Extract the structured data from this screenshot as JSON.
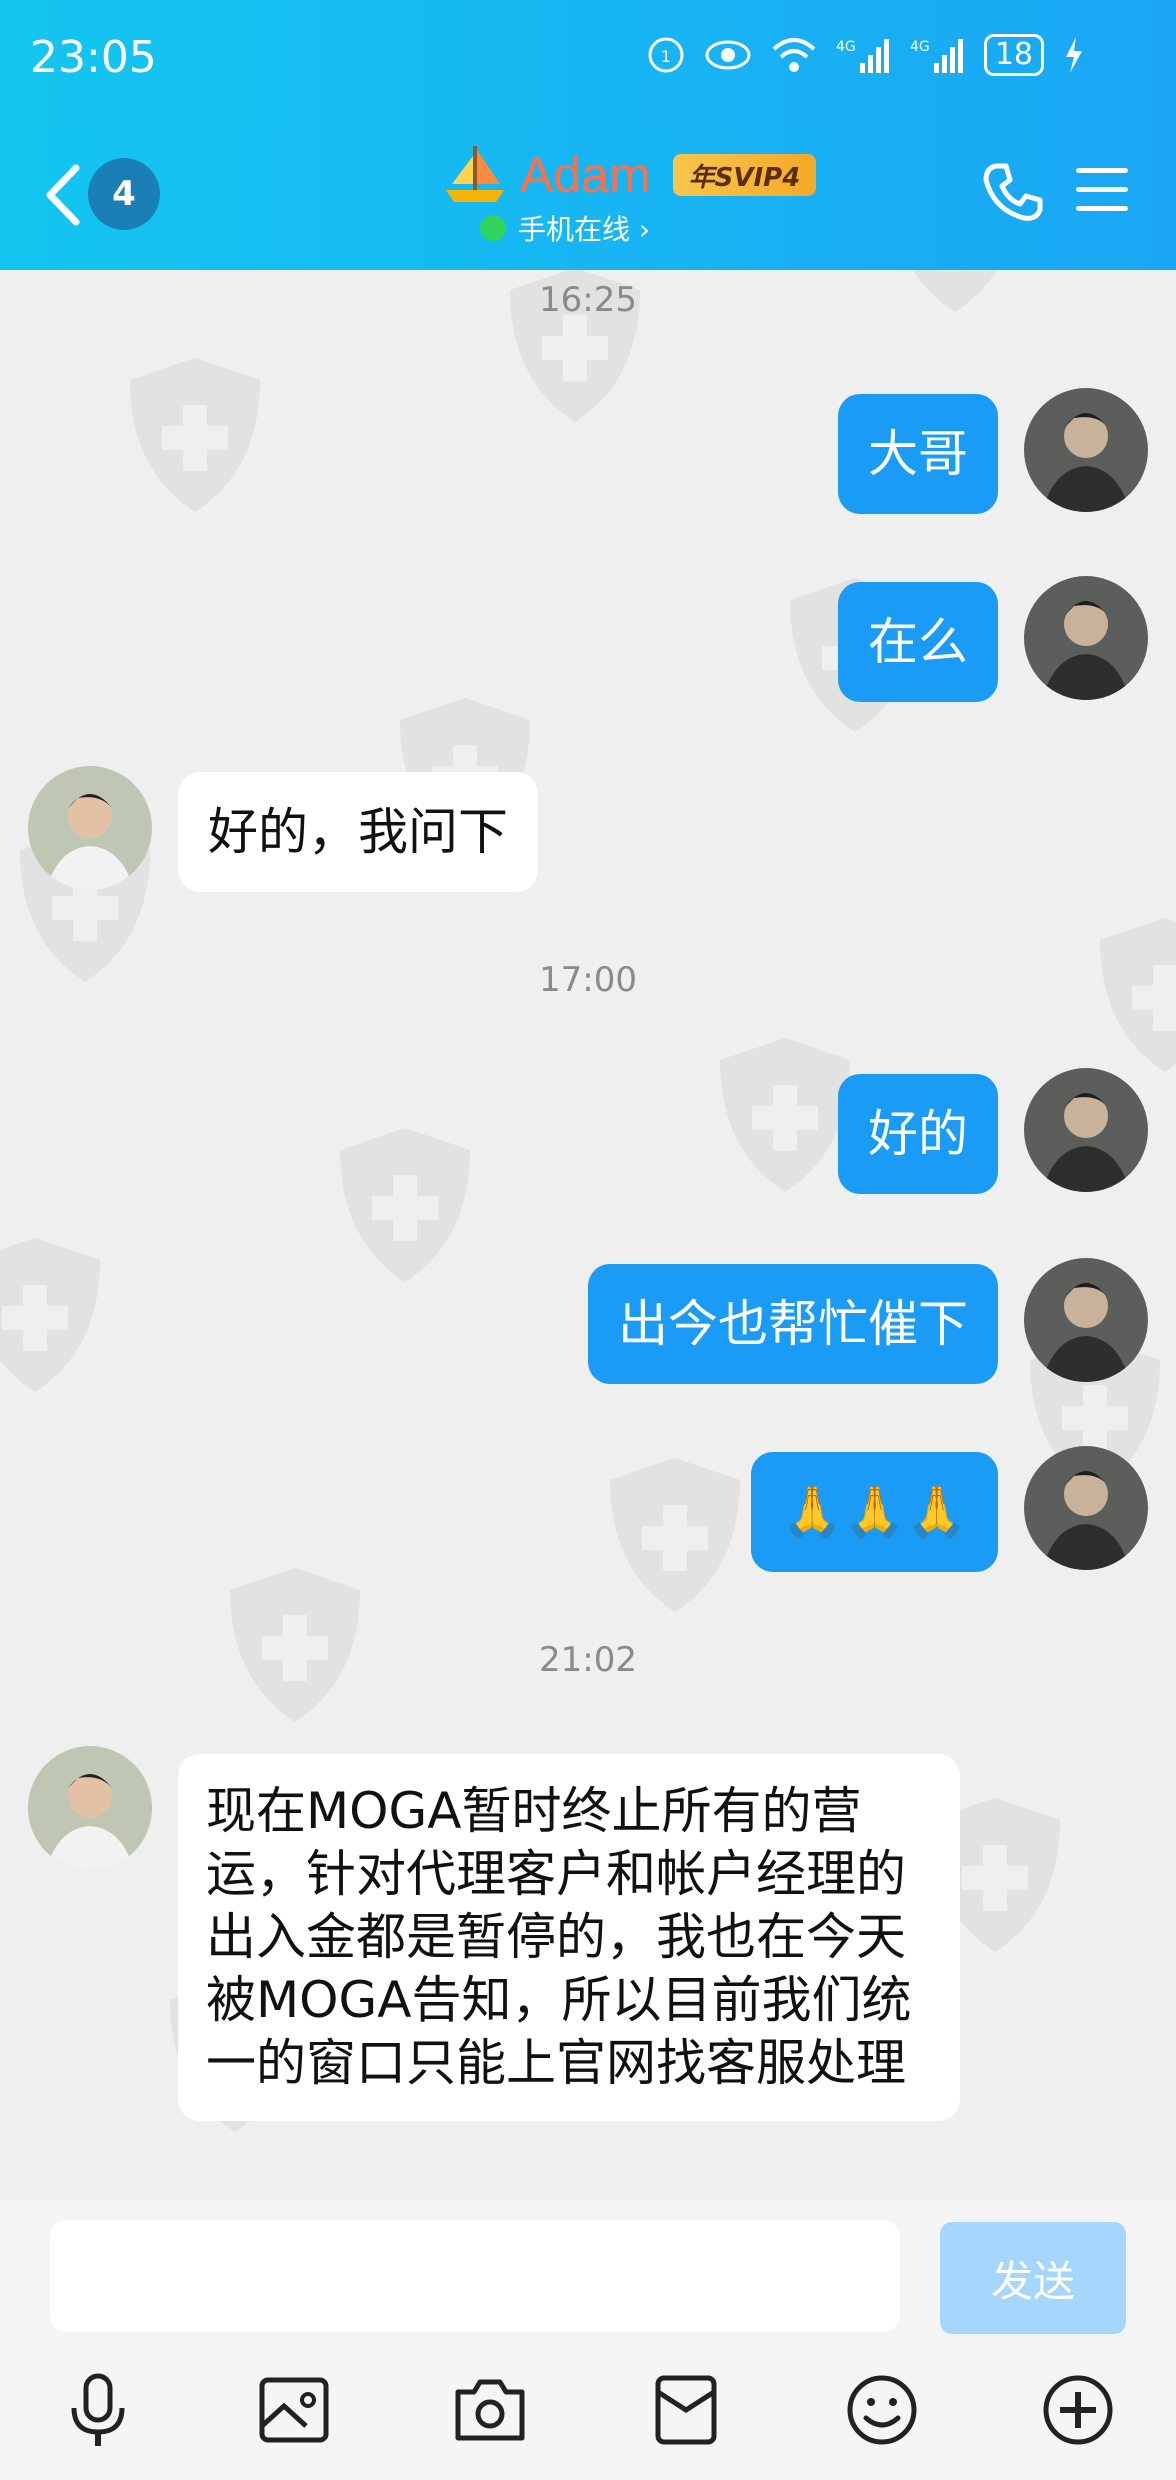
{
  "status_bar": {
    "time": "23:05",
    "battery": "18"
  },
  "header": {
    "back_count": "4",
    "contact_name": "Adam",
    "vip_label": "年SVIP4",
    "online_status": "手机在线 ›"
  },
  "messages": [
    {
      "type": "time",
      "text": "16:25"
    },
    {
      "type": "me",
      "text": "大哥"
    },
    {
      "type": "me",
      "text": "在么"
    },
    {
      "type": "other",
      "text": "好的，我问下"
    },
    {
      "type": "time",
      "text": "17:00"
    },
    {
      "type": "me",
      "text": "好的"
    },
    {
      "type": "me",
      "text": "出今也帮忙催下"
    },
    {
      "type": "me",
      "text": "🙏🙏🙏"
    },
    {
      "type": "time",
      "text": "21:02"
    },
    {
      "type": "other",
      "text": "现在MOGA暂时终止所有的营运，针对代理客户和帐户经理的出入金都是暂停的，我也在今天被MOGA告知，所以目前我们统一的窗口只能上官网找客服处理"
    }
  ],
  "input": {
    "placeholder": "",
    "send_label": "发送"
  },
  "toolbar": {
    "icons": [
      "microphone-icon",
      "image-icon",
      "camera-icon",
      "red-packet-icon",
      "emoji-icon",
      "plus-icon"
    ]
  },
  "colors": {
    "header_start": "#14c6ef",
    "header_end": "#1aa6f4",
    "my_bubble": "#1a9bf6",
    "other_bubble": "#ffffff",
    "send_disabled": "#a4d7fb"
  }
}
